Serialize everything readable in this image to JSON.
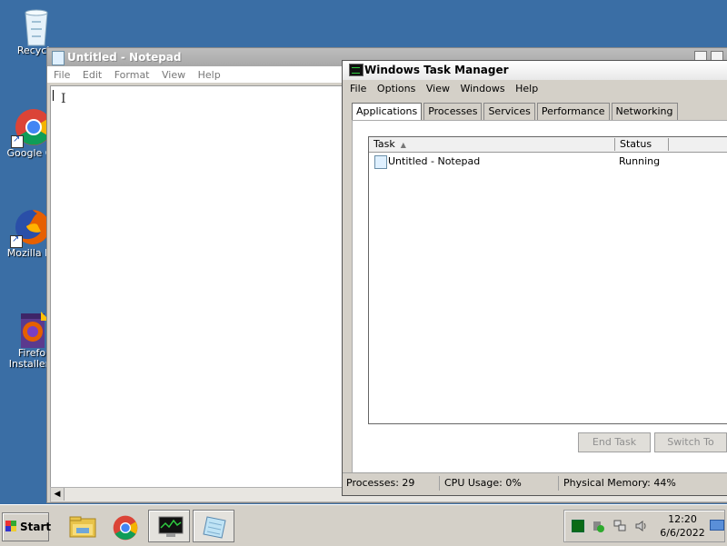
{
  "desktop": {
    "icons": [
      {
        "label": "Recycle",
        "icon": "recycle-bin-icon"
      },
      {
        "label": "Google Ch",
        "icon": "chrome-icon"
      },
      {
        "label": "Mozilla Fir",
        "icon": "firefox-icon"
      },
      {
        "label": "Firefo",
        "label2": "Installer..",
        "icon": "firefox-installer-icon"
      }
    ]
  },
  "notepad": {
    "title": "Untitled - Notepad",
    "menu": [
      "File",
      "Edit",
      "Format",
      "View",
      "Help"
    ],
    "content": "",
    "cursor_glyph": "I"
  },
  "taskmgr": {
    "title": "Windows Task Manager",
    "menu": [
      "File",
      "Options",
      "View",
      "Windows",
      "Help"
    ],
    "tabs": [
      "Applications",
      "Processes",
      "Services",
      "Performance",
      "Networking"
    ],
    "active_tab": "Applications",
    "columns": {
      "task": "Task",
      "status": "Status"
    },
    "rows": [
      {
        "task": "Untitled - Notepad",
        "status": "Running"
      }
    ],
    "buttons": {
      "end_task": "End Task",
      "switch_to": "Switch To"
    },
    "status": {
      "processes": "Processes: 29",
      "cpu": "CPU Usage: 0%",
      "memory": "Physical Memory: 44%"
    }
  },
  "taskbar": {
    "start_label": "Start",
    "pinned": [
      "file-explorer-icon",
      "chrome-icon",
      "task-manager-icon",
      "notepad-icon"
    ],
    "clock": {
      "time": "12:20",
      "date": "6/6/2022"
    }
  },
  "colors": {
    "desktop": "#3a6ea5",
    "window": "#d4d0c8"
  }
}
